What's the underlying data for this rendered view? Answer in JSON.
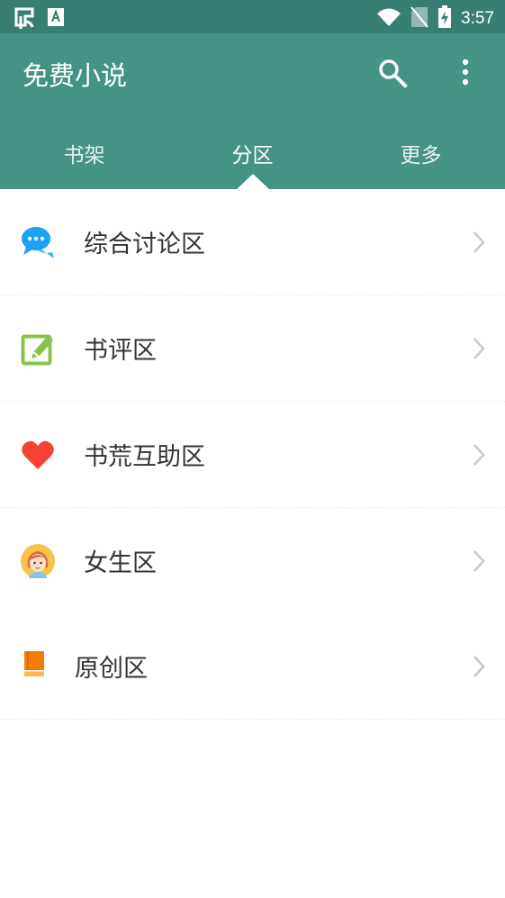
{
  "status_bar": {
    "left_icons": [
      "bug-icon",
      "text-icon"
    ],
    "right_icons": [
      "wifi-icon",
      "no-sim-icon",
      "battery-charging-icon"
    ],
    "time": "3:57"
  },
  "app_bar": {
    "title": "免费小说",
    "actions": [
      "search-icon",
      "more-vertical-icon"
    ],
    "color": "#439484",
    "status_color": "#387f73"
  },
  "tabs": [
    {
      "label": "书架",
      "active": false
    },
    {
      "label": "分区",
      "active": true
    },
    {
      "label": "更多",
      "active": false
    }
  ],
  "sections": [
    {
      "label": "综合讨论区",
      "icon": "chat-bubble-icon",
      "icon_color": "#1da1f2"
    },
    {
      "label": "书评区",
      "icon": "edit-note-icon",
      "icon_color": "#8bc34a"
    },
    {
      "label": "书荒互助区",
      "icon": "heart-icon",
      "icon_color": "#f44336"
    },
    {
      "label": "女生区",
      "icon": "girl-avatar-icon",
      "icon_color": "#f6c34b"
    },
    {
      "label": "原创区",
      "icon": "book-icon",
      "icon_color": "#f57c00"
    }
  ]
}
